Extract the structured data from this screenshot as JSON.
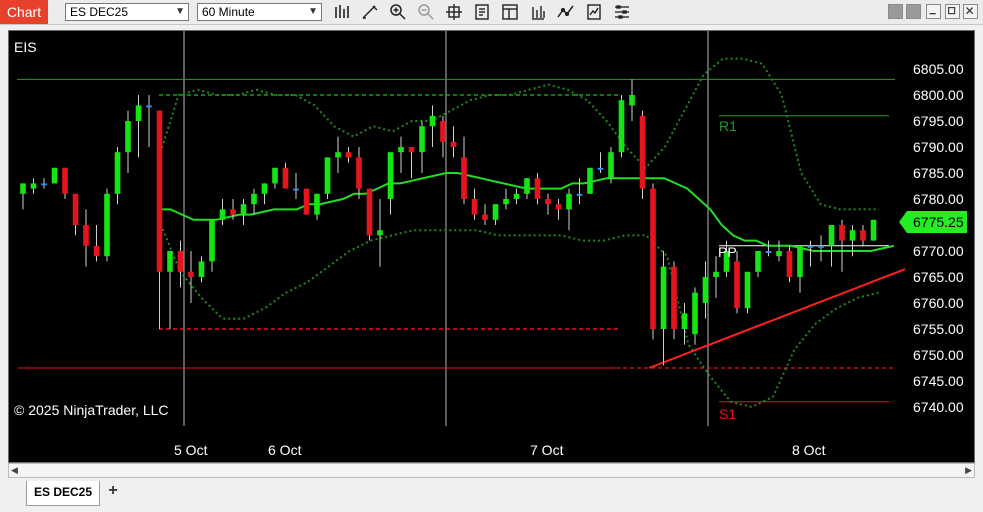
{
  "titlebar": {
    "tab_label": "Chart",
    "instrument": "ES DEC25",
    "interval": "60 Minute",
    "toolbar_icons": [
      "bar-type-icon",
      "drawing-tool-icon",
      "zoom-in-icon",
      "zoom-out-icon",
      "crosshair-icon",
      "properties-icon",
      "data-box-icon",
      "strategies-icon",
      "indicators-icon",
      "templates-icon",
      "chart-trader-icon"
    ]
  },
  "chart": {
    "instrument_label": "EIS",
    "copyright": "© 2025 NinjaTrader, LLC",
    "price_labels": [
      "6805.00",
      "6800.00",
      "6795.00",
      "6790.00",
      "6785.00",
      "6780.00",
      "6770.00",
      "6765.00",
      "6760.00",
      "6755.00",
      "6750.00",
      "6745.00",
      "6740.00"
    ],
    "last_price": "6775.25",
    "date_labels": [
      "5 Oct",
      "6 Oct",
      "7 Oct",
      "8 Oct"
    ],
    "pivot_labels": {
      "r1": "R1",
      "pp": "PP",
      "s1": "S1"
    },
    "colors": {
      "up": "#14e614",
      "down": "#e6141e",
      "flat": "#3a8fe6",
      "ma": "#22dd22",
      "band": "#1f8a1f",
      "last_price_bg": "#22ee22"
    }
  },
  "chart_data": {
    "type": "candlestick",
    "instrument": "EIS",
    "ylim": [
      6737,
      6810
    ],
    "y_ticks": [
      6805,
      6800,
      6795,
      6790,
      6785,
      6780,
      6770,
      6765,
      6760,
      6755,
      6750,
      6745,
      6740
    ],
    "x_labels": [
      "5 Oct",
      "6 Oct",
      "7 Oct",
      "8 Oct"
    ],
    "last_price": 6775.25,
    "candles": [
      {
        "o": 6781,
        "h": 6783,
        "l": 6778,
        "c": 6783
      },
      {
        "o": 6782,
        "h": 6784,
        "l": 6781,
        "c": 6783
      },
      {
        "o": 6783,
        "h": 6784,
        "l": 6782,
        "c": 6783
      },
      {
        "o": 6783,
        "h": 6786,
        "l": 6783,
        "c": 6786
      },
      {
        "o": 6786,
        "h": 6786,
        "l": 6780,
        "c": 6781
      },
      {
        "o": 6781,
        "h": 6781,
        "l": 6773,
        "c": 6775
      },
      {
        "o": 6775,
        "h": 6778,
        "l": 6767,
        "c": 6771
      },
      {
        "o": 6771,
        "h": 6775,
        "l": 6768,
        "c": 6769
      },
      {
        "o": 6769,
        "h": 6782,
        "l": 6768,
        "c": 6781
      },
      {
        "o": 6781,
        "h": 6790,
        "l": 6779,
        "c": 6789
      },
      {
        "o": 6789,
        "h": 6797,
        "l": 6785,
        "c": 6795
      },
      {
        "o": 6795,
        "h": 6800,
        "l": 6788,
        "c": 6798
      },
      {
        "o": 6798,
        "h": 6800,
        "l": 6790,
        "c": 6798
      },
      {
        "o": 6797,
        "h": 6797,
        "l": 6755,
        "c": 6766
      },
      {
        "o": 6766,
        "h": 6770,
        "l": 6755,
        "c": 6770
      },
      {
        "o": 6770,
        "h": 6772,
        "l": 6763,
        "c": 6766
      },
      {
        "o": 6766,
        "h": 6770,
        "l": 6760,
        "c": 6765
      },
      {
        "o": 6765,
        "h": 6769,
        "l": 6764,
        "c": 6768
      },
      {
        "o": 6768,
        "h": 6776,
        "l": 6766,
        "c": 6776
      },
      {
        "o": 6776,
        "h": 6780,
        "l": 6775,
        "c": 6778
      },
      {
        "o": 6778,
        "h": 6780,
        "l": 6776,
        "c": 6777
      },
      {
        "o": 6777,
        "h": 6780,
        "l": 6775,
        "c": 6779
      },
      {
        "o": 6779,
        "h": 6782,
        "l": 6777,
        "c": 6781
      },
      {
        "o": 6781,
        "h": 6783,
        "l": 6779,
        "c": 6783
      },
      {
        "o": 6783,
        "h": 6786,
        "l": 6782,
        "c": 6786
      },
      {
        "o": 6786,
        "h": 6787,
        "l": 6782,
        "c": 6782
      },
      {
        "o": 6782,
        "h": 6785,
        "l": 6780,
        "c": 6782
      },
      {
        "o": 6782,
        "h": 6782,
        "l": 6777,
        "c": 6777
      },
      {
        "o": 6777,
        "h": 6781,
        "l": 6776,
        "c": 6781
      },
      {
        "o": 6781,
        "h": 6788,
        "l": 6780,
        "c": 6788
      },
      {
        "o": 6788,
        "h": 6792,
        "l": 6785,
        "c": 6789
      },
      {
        "o": 6789,
        "h": 6790,
        "l": 6787,
        "c": 6788
      },
      {
        "o": 6788,
        "h": 6790,
        "l": 6780,
        "c": 6782
      },
      {
        "o": 6782,
        "h": 6782,
        "l": 6772,
        "c": 6773
      },
      {
        "o": 6773,
        "h": 6780,
        "l": 6767,
        "c": 6774
      },
      {
        "o": 6780,
        "h": 6788,
        "l": 6777,
        "c": 6789
      },
      {
        "o": 6789,
        "h": 6792,
        "l": 6785,
        "c": 6790
      },
      {
        "o": 6790,
        "h": 6790,
        "l": 6784,
        "c": 6789
      },
      {
        "o": 6789,
        "h": 6795,
        "l": 6785,
        "c": 6794
      },
      {
        "o": 6794,
        "h": 6798,
        "l": 6790,
        "c": 6796
      },
      {
        "o": 6795,
        "h": 6796,
        "l": 6788,
        "c": 6791
      },
      {
        "o": 6791,
        "h": 6794,
        "l": 6788,
        "c": 6790
      },
      {
        "o": 6788,
        "h": 6792,
        "l": 6779,
        "c": 6780
      },
      {
        "o": 6780,
        "h": 6782,
        "l": 6776,
        "c": 6777
      },
      {
        "o": 6777,
        "h": 6779,
        "l": 6775,
        "c": 6776
      },
      {
        "o": 6776,
        "h": 6779,
        "l": 6775,
        "c": 6779
      },
      {
        "o": 6779,
        "h": 6782,
        "l": 6778,
        "c": 6780
      },
      {
        "o": 6780,
        "h": 6782,
        "l": 6779,
        "c": 6781
      },
      {
        "o": 6781,
        "h": 6784,
        "l": 6780,
        "c": 6784
      },
      {
        "o": 6784,
        "h": 6785,
        "l": 6779,
        "c": 6780
      },
      {
        "o": 6780,
        "h": 6781,
        "l": 6777,
        "c": 6779
      },
      {
        "o": 6779,
        "h": 6780,
        "l": 6776,
        "c": 6778
      },
      {
        "o": 6778,
        "h": 6782,
        "l": 6774,
        "c": 6781
      },
      {
        "o": 6781,
        "h": 6784,
        "l": 6779,
        "c": 6781
      },
      {
        "o": 6781,
        "h": 6786,
        "l": 6781,
        "c": 6786
      },
      {
        "o": 6786,
        "h": 6789,
        "l": 6785,
        "c": 6786
      },
      {
        "o": 6784,
        "h": 6790,
        "l": 6783,
        "c": 6789
      },
      {
        "o": 6789,
        "h": 6800,
        "l": 6788,
        "c": 6799
      },
      {
        "o": 6798,
        "h": 6803,
        "l": 6795,
        "c": 6800
      },
      {
        "o": 6796,
        "h": 6797,
        "l": 6780,
        "c": 6782
      },
      {
        "o": 6782,
        "h": 6783,
        "l": 6753,
        "c": 6755
      },
      {
        "o": 6755,
        "h": 6770,
        "l": 6748,
        "c": 6767
      },
      {
        "o": 6767,
        "h": 6768,
        "l": 6753,
        "c": 6755
      },
      {
        "o": 6755,
        "h": 6760,
        "l": 6752,
        "c": 6758
      },
      {
        "o": 6754,
        "h": 6763,
        "l": 6752,
        "c": 6762
      },
      {
        "o": 6760,
        "h": 6768,
        "l": 6757,
        "c": 6765
      },
      {
        "o": 6765,
        "h": 6769,
        "l": 6761,
        "c": 6766
      },
      {
        "o": 6766,
        "h": 6772,
        "l": 6765,
        "c": 6770
      },
      {
        "o": 6768,
        "h": 6770,
        "l": 6758,
        "c": 6759
      },
      {
        "o": 6759,
        "h": 6766,
        "l": 6758,
        "c": 6766
      },
      {
        "o": 6766,
        "h": 6770,
        "l": 6765,
        "c": 6770
      },
      {
        "o": 6770,
        "h": 6772,
        "l": 6769,
        "c": 6770
      },
      {
        "o": 6769,
        "h": 6772,
        "l": 6768,
        "c": 6770
      },
      {
        "o": 6770,
        "h": 6771,
        "l": 6764,
        "c": 6765
      },
      {
        "o": 6765,
        "h": 6770,
        "l": 6762,
        "c": 6771
      },
      {
        "o": 6771,
        "h": 6772,
        "l": 6767,
        "c": 6771
      },
      {
        "o": 6771,
        "h": 6773,
        "l": 6768,
        "c": 6771
      },
      {
        "o": 6771,
        "h": 6775,
        "l": 6767,
        "c": 6775
      },
      {
        "o": 6775,
        "h": 6776,
        "l": 6766,
        "c": 6772
      },
      {
        "o": 6772,
        "h": 6775,
        "l": 6769,
        "c": 6774
      },
      {
        "o": 6774,
        "h": 6775,
        "l": 6771,
        "c": 6772
      },
      {
        "o": 6772,
        "h": 6776,
        "l": 6772,
        "c": 6776
      }
    ],
    "sma_line": [
      6778,
      6778,
      6777,
      6776,
      6776,
      6776,
      6776.5,
      6777,
      6777,
      6777.5,
      6778,
      6778,
      6778,
      6779,
      6779,
      6779.5,
      6780,
      6781,
      6781,
      6782,
      6783,
      6783,
      6783.5,
      6784,
      6784.5,
      6785,
      6785,
      6784.5,
      6784,
      6783.5,
      6783,
      6782.5,
      6782,
      6782,
      6782,
      6782,
      6783,
      6783,
      6783.5,
      6784,
      6784,
      6784,
      6784,
      6784,
      6784,
      6783,
      6782,
      6780,
      6778,
      6775,
      6773,
      6772,
      6772,
      6771,
      6771,
      6771,
      6770.5,
      6770,
      6770,
      6770,
      6770,
      6770,
      6770,
      6770.5,
      6771
    ],
    "bollinger_upper": [
      6788,
      6800,
      6801,
      6800,
      6800,
      6801,
      6800,
      6800,
      6798,
      6794,
      6792,
      6794,
      6793,
      6795,
      6795,
      6797,
      6799,
      6800,
      6800,
      6801,
      6802,
      6801,
      6799,
      6795,
      6790,
      6786,
      6790,
      6797,
      6804,
      6807,
      6807,
      6806,
      6800,
      6785,
      6779,
      6778,
      6778,
      6778
    ],
    "bollinger_lower": [
      6776,
      6766,
      6761,
      6757,
      6757,
      6759,
      6762,
      6764,
      6767,
      6770,
      6772,
      6773,
      6774,
      6774,
      6774,
      6774,
      6773,
      6773,
      6773,
      6773,
      6772,
      6772,
      6773,
      6773,
      6769,
      6752,
      6746,
      6741,
      6740,
      6742,
      6751,
      6756,
      6759,
      6761,
      6762
    ],
    "pivots": {
      "R1": 6796,
      "PP": 6771,
      "S1": 6741
    },
    "horizontal_lines": [
      {
        "price": 6803,
        "style": "solid",
        "color": "green"
      },
      {
        "price": 6800,
        "style": "dashed",
        "color": "green"
      },
      {
        "price": 6755,
        "style": "dashed",
        "color": "red"
      },
      {
        "price": 6747.5,
        "style": "solid",
        "color": "red"
      }
    ],
    "trend_line": {
      "from": 6747.5,
      "to": 6766.5,
      "color": "red"
    }
  }
}
